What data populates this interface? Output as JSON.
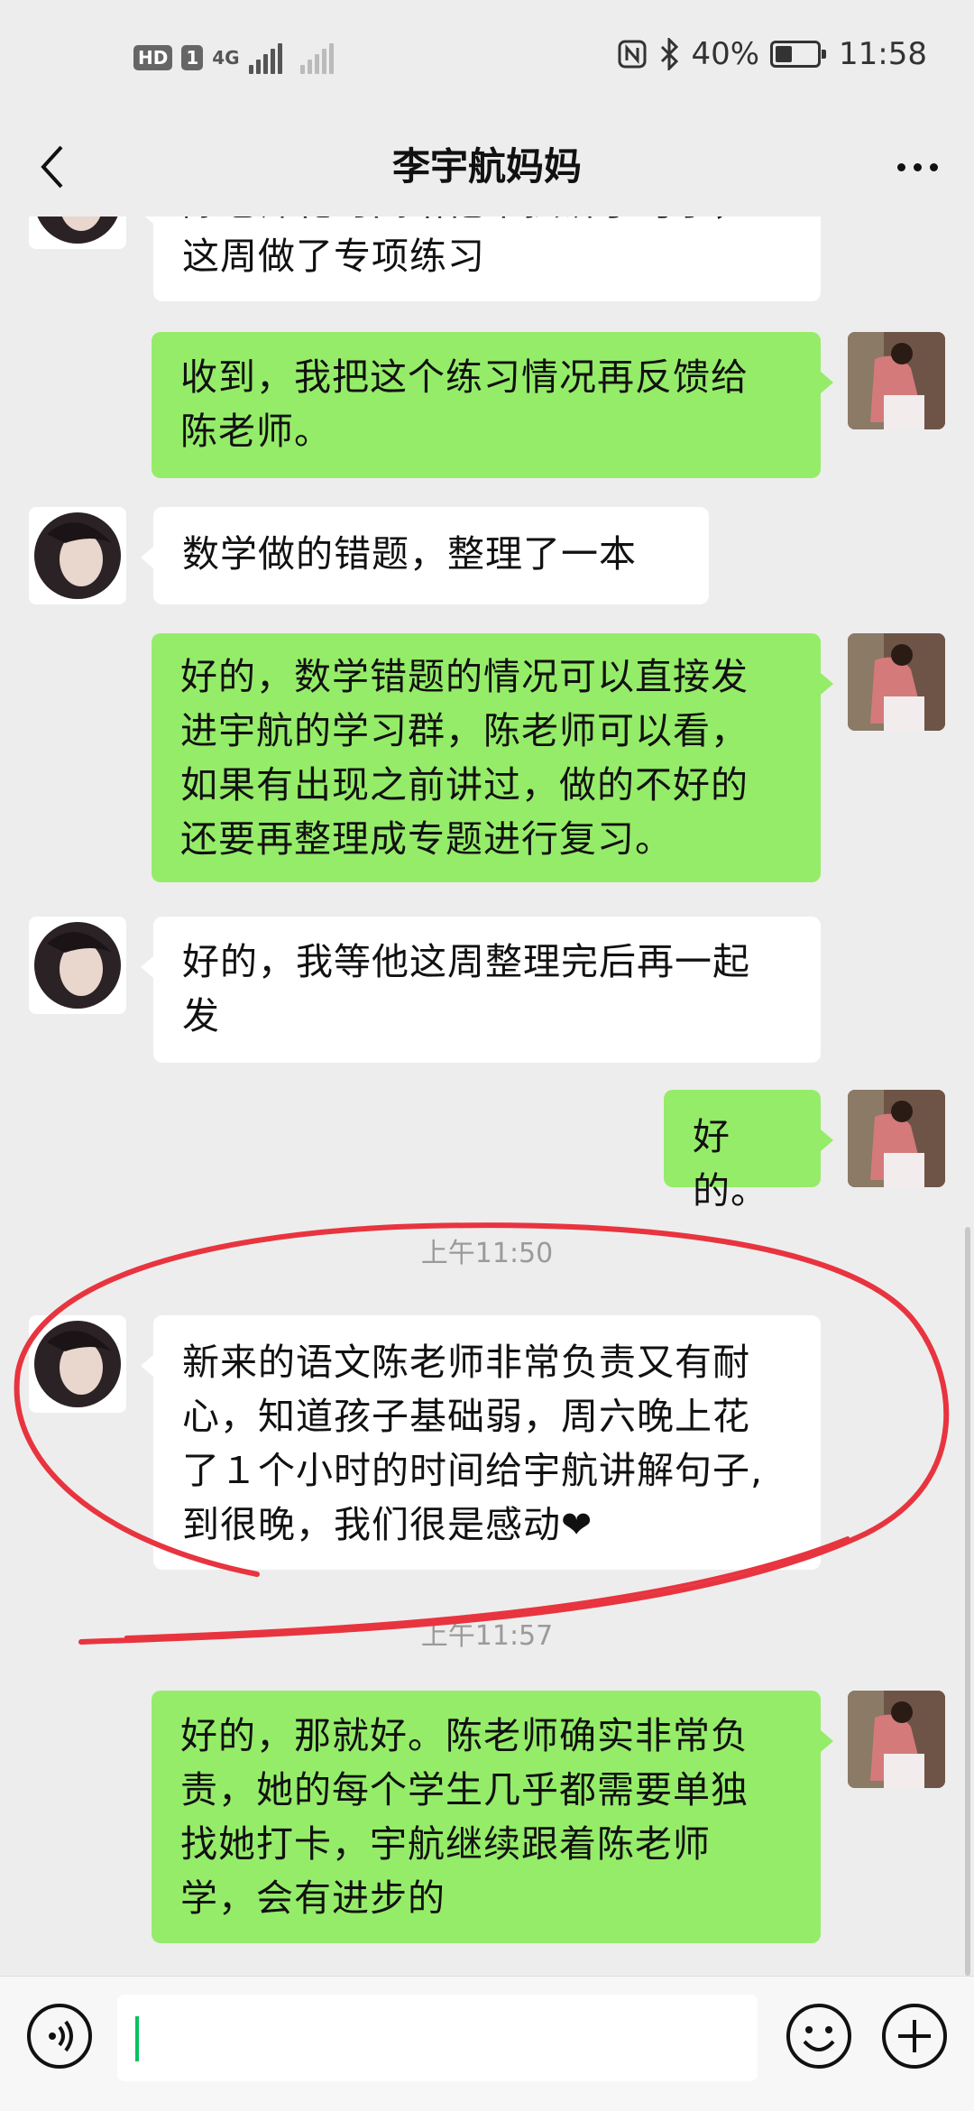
{
  "status_bar": {
    "hd_badge": "HD",
    "sim_badge": "1",
    "network": "4G",
    "battery": "40%",
    "battery_level": 0.4,
    "time": "11:58"
  },
  "header": {
    "title": "李宇航妈妈"
  },
  "messages": [
    {
      "side": "left",
      "lines": [
        "陈老师花时间给他单独讲了句子，",
        "这周做了专项练习"
      ]
    },
    {
      "side": "right",
      "lines": [
        "收到，我把这个练习情况再反馈给",
        "陈老师。"
      ]
    },
    {
      "side": "left",
      "lines": [
        "数学做的错题，整理了一本"
      ]
    },
    {
      "side": "right",
      "lines": [
        "好的，数学错题的情况可以直接发",
        "进宇航的学习群，陈老师可以看，",
        "如果有出现之前讲过，做的不好的",
        "还要再整理成专题进行复习。"
      ]
    },
    {
      "side": "left",
      "lines": [
        "好的，我等他这周整理完后再一起",
        "发"
      ]
    },
    {
      "side": "right",
      "lines": [
        "好的。"
      ]
    },
    {
      "side": "left",
      "lines": [
        "新来的语文陈老师非常负责又有耐",
        "心，知道孩子基础弱，周六晚上花",
        "了１个小时的时间给宇航讲解句子,",
        "到很晚，我们很是感动❤"
      ]
    },
    {
      "side": "right",
      "lines": [
        "好的，那就好。陈老师确实非常负",
        "责，她的每个学生几乎都需要单独",
        "找她打卡，宇航继续跟着陈老师",
        "学，会有进步的"
      ]
    }
  ],
  "timestamps": [
    "上午11:50",
    "上午11:57"
  ],
  "colors": {
    "background": "#ededed",
    "bubble_right": "#95ec69",
    "bubble_left": "#ffffff",
    "annotation": "#e8343f",
    "cursor": "#07c160"
  },
  "icons": {
    "back": "chevron-left-icon",
    "more": "more-dots-icon",
    "voice": "voice-icon",
    "emoji": "emoji-icon",
    "plus": "plus-icon"
  },
  "input": {
    "value": ""
  }
}
